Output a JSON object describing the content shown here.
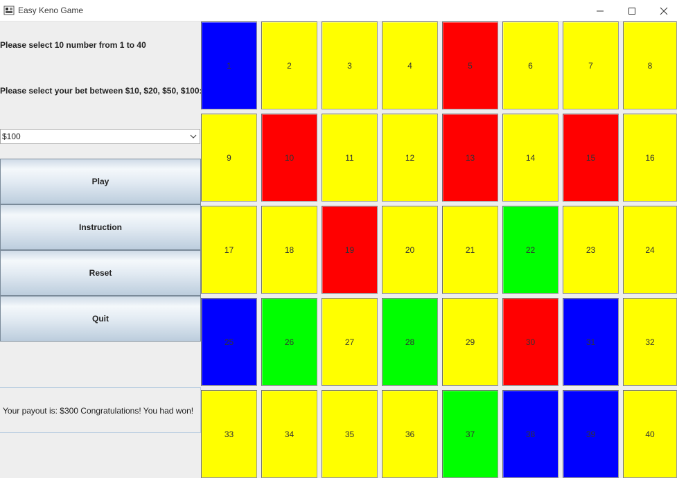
{
  "window": {
    "title": "Easy Keno Game"
  },
  "instructions": {
    "select_numbers": "Please select 10 number from 1 to 40",
    "select_bet": "Please select your bet between $10, $20, $50, $100:"
  },
  "bet_select": {
    "value": "$100"
  },
  "buttons": {
    "play": "Play",
    "instruction": "Instruction",
    "reset": "Reset",
    "quit": "Quit"
  },
  "result": {
    "text": "Your payout is: $300 Congratulations! You had won!"
  },
  "colors": {
    "yellow": "#ffff00",
    "red": "#ff0000",
    "blue": "#0000ff",
    "green": "#00ff00"
  },
  "cells": [
    {
      "label": "1",
      "color": "blue"
    },
    {
      "label": "2",
      "color": "yellow"
    },
    {
      "label": "3",
      "color": "yellow"
    },
    {
      "label": "4",
      "color": "yellow"
    },
    {
      "label": "5",
      "color": "red"
    },
    {
      "label": "6",
      "color": "yellow"
    },
    {
      "label": "7",
      "color": "yellow"
    },
    {
      "label": "8",
      "color": "yellow"
    },
    {
      "label": "9",
      "color": "yellow"
    },
    {
      "label": "10",
      "color": "red"
    },
    {
      "label": "11",
      "color": "yellow"
    },
    {
      "label": "12",
      "color": "yellow"
    },
    {
      "label": "13",
      "color": "red"
    },
    {
      "label": "14",
      "color": "yellow"
    },
    {
      "label": "15",
      "color": "red"
    },
    {
      "label": "16",
      "color": "yellow"
    },
    {
      "label": "17",
      "color": "yellow"
    },
    {
      "label": "18",
      "color": "yellow"
    },
    {
      "label": "19",
      "color": "red"
    },
    {
      "label": "20",
      "color": "yellow"
    },
    {
      "label": "21",
      "color": "yellow"
    },
    {
      "label": "22",
      "color": "green"
    },
    {
      "label": "23",
      "color": "yellow"
    },
    {
      "label": "24",
      "color": "yellow"
    },
    {
      "label": "25",
      "color": "blue"
    },
    {
      "label": "26",
      "color": "green"
    },
    {
      "label": "27",
      "color": "yellow"
    },
    {
      "label": "28",
      "color": "green"
    },
    {
      "label": "29",
      "color": "yellow"
    },
    {
      "label": "30",
      "color": "red"
    },
    {
      "label": "31",
      "color": "blue"
    },
    {
      "label": "32",
      "color": "yellow"
    },
    {
      "label": "33",
      "color": "yellow"
    },
    {
      "label": "34",
      "color": "yellow"
    },
    {
      "label": "35",
      "color": "yellow"
    },
    {
      "label": "36",
      "color": "yellow"
    },
    {
      "label": "37",
      "color": "green"
    },
    {
      "label": "38",
      "color": "blue"
    },
    {
      "label": "39",
      "color": "blue"
    },
    {
      "label": "40",
      "color": "yellow"
    }
  ]
}
